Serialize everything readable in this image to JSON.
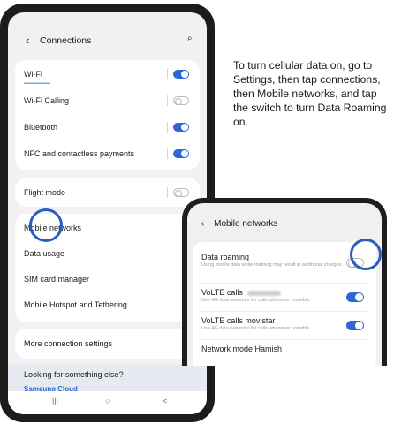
{
  "phone1": {
    "header": {
      "back_icon": "chevron-left-icon",
      "title": "Connections",
      "search_icon": "search-icon"
    },
    "group1": [
      {
        "label": "Wi-Fi",
        "toggle": "on",
        "has_sub": true
      },
      {
        "label": "Wi-Fi Calling",
        "toggle": "off"
      },
      {
        "label": "Bluetooth",
        "toggle": "on"
      },
      {
        "label": "NFC and contactless payments",
        "toggle": "on"
      }
    ],
    "group2": [
      {
        "label": "Flight mode",
        "toggle": "off"
      }
    ],
    "group3": [
      {
        "label": "Mobile networks"
      },
      {
        "label": "Data usage"
      },
      {
        "label": "SIM card manager"
      },
      {
        "label": "Mobile Hotspot and Tethering"
      }
    ],
    "group4": [
      {
        "label": "More connection settings"
      }
    ],
    "suggest": {
      "text": "Looking for something else?",
      "link": "Samsung Cloud"
    },
    "navbar": {
      "recent": "|||",
      "home": "○",
      "back": "<"
    }
  },
  "instructions": "To turn cellular data on, go to Settings, then tap connections, then Mobile networks, and tap the switch to turn Data Roaming on.",
  "phone2": {
    "header": {
      "back_icon": "chevron-left-icon",
      "title": "Mobile networks"
    },
    "items": [
      {
        "label": "Data roaming",
        "sub": "Using mobile data while roaming may result in additional charges.",
        "toggle": "off"
      },
      {
        "label": "VoLTE calls",
        "sub": "Use 4G data networks for calls whenever possible.",
        "toggle": "on"
      },
      {
        "label": "VoLTE calls movistar",
        "sub": "Use 4G data networks for calls whenever possible.",
        "toggle": "on"
      },
      {
        "label": "Network mode Hamish"
      }
    ]
  },
  "colors": {
    "accent": "#2d67d4",
    "highlight": "#2a5cc0"
  }
}
